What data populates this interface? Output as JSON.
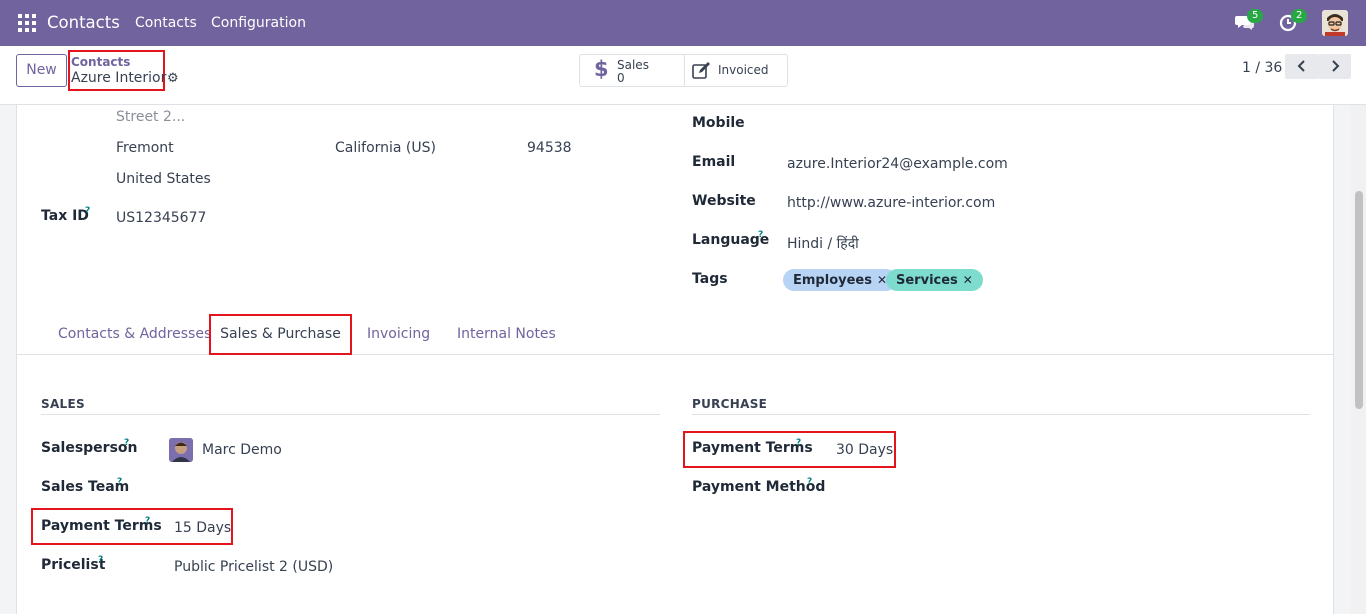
{
  "navbar": {
    "app_name": "Contacts",
    "menu": [
      "Contacts",
      "Configuration"
    ],
    "messages_count": "5",
    "activities_count": "2"
  },
  "control_panel": {
    "new_button": "New",
    "breadcrumb_parent": "Contacts",
    "breadcrumb_current": "Azure Interior",
    "stat_sales_label": "Sales",
    "stat_sales_value": "0",
    "stat_invoiced_label": "Invoiced",
    "pager": "1 / 36"
  },
  "address": {
    "street2_placeholder": "Street 2...",
    "city": "Fremont",
    "state": "California (US)",
    "zip": "94538",
    "country": "United States"
  },
  "left_fields": {
    "tax_id_label": "Tax ID",
    "tax_id_value": "US12345677"
  },
  "right_fields": {
    "mobile_label": "Mobile",
    "email_label": "Email",
    "email_value": "azure.Interior24@example.com",
    "website_label": "Website",
    "website_value": "http://www.azure-interior.com",
    "language_label": "Language",
    "language_value": "Hindi / हिंदी",
    "tags_label": "Tags",
    "tags": [
      {
        "label": "Employees",
        "color": "#b8d4f5"
      },
      {
        "label": "Services",
        "color": "#7ddccd"
      }
    ]
  },
  "tabs": {
    "contacts": "Contacts & Addresses",
    "sales_purchase": "Sales & Purchase",
    "invoicing": "Invoicing",
    "notes": "Internal Notes"
  },
  "sales": {
    "title": "SALES",
    "salesperson_label": "Salesperson",
    "salesperson_value": "Marc Demo",
    "team_label": "Sales Team",
    "payment_terms_label": "Payment Terms",
    "payment_terms_value": "15 Days",
    "pricelist_label": "Pricelist",
    "pricelist_value": "Public Pricelist 2 (USD)"
  },
  "purchase": {
    "title": "PURCHASE",
    "payment_terms_label": "Payment Terms",
    "payment_terms_value": "30 Days",
    "payment_method_label": "Payment Method"
  },
  "help_mark": "?",
  "colors": {
    "brand": "#71639e",
    "highlight": "#e3141c"
  }
}
